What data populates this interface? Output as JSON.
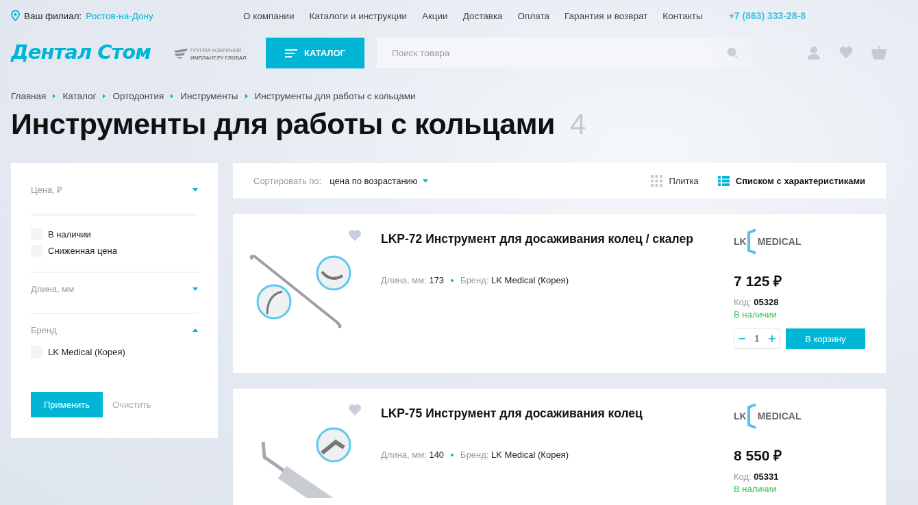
{
  "top_bar": {
    "branch_label": "Ваш филиал:",
    "branch_city": "Ростов-на-Дону",
    "nav": [
      "О компании",
      "Каталоги и инструкции",
      "Акции",
      "Доставка",
      "Оплата",
      "Гарантия и возврат",
      "Контакты"
    ],
    "phone": "+7 (863) 333-28-8"
  },
  "header": {
    "logo": "Дентал Стом",
    "group_caption": "ГРУППА КОМПАНИЙ",
    "group_name": "ИМПЛАНТ.РУ ГЛОБАЛ",
    "catalog_button": "КАТАЛОГ",
    "search": {
      "placeholder": "Поиск товара"
    }
  },
  "breadcrumbs": [
    "Главная",
    "Каталог",
    "Ортодонтия",
    "Инструменты",
    "Инструменты для работы с кольцами"
  ],
  "title": "Инструменты для работы с кольцами",
  "count": "4",
  "filters": [
    {
      "kind": "section",
      "title": "Цена, ₽",
      "expanded": false
    },
    {
      "kind": "checks",
      "items": [
        {
          "label": "В наличии",
          "checked": false
        },
        {
          "label": "Сниженная цена",
          "checked": false
        }
      ]
    },
    {
      "kind": "section",
      "title": "Длина, мм",
      "expanded": false
    },
    {
      "kind": "section",
      "title": "Бренд",
      "expanded": true,
      "items": [
        {
          "label": "LK Medical (Корея)",
          "checked": false
        }
      ]
    }
  ],
  "filter_buttons": {
    "apply": "Применить",
    "clear": "Очистить"
  },
  "sort": {
    "label": "Сортировать по:",
    "value": "цена по возрастанию"
  },
  "views": [
    {
      "label": "Плитка",
      "kind": "grid",
      "selected": false
    },
    {
      "label": "Списком с характеристиками",
      "kind": "list",
      "selected": true
    }
  ],
  "products": [
    {
      "title": "LKP-72 Инструмент для досаживания колец / скалер",
      "kind": "scaler",
      "specs": [
        {
          "label": "Длина, мм:",
          "value": "173"
        },
        {
          "label": "Бренд:",
          "value": "LK Medical (Корея)"
        }
      ],
      "brand_logo": {
        "left": "LK",
        "right": "MEDICAL"
      },
      "price": "7 125 ₽",
      "code_label": "Код:",
      "code": "05328",
      "stock": "В наличии",
      "quantity": "1",
      "cart_button": "В корзину"
    },
    {
      "title": "LKP-75 Инструмент для досаживания колец",
      "kind": "pusher",
      "specs": [
        {
          "label": "Длина, мм:",
          "value": "140"
        },
        {
          "label": "Бренд:",
          "value": "LK Medical (Корея)"
        }
      ],
      "brand_logo": {
        "left": "LK",
        "right": "MEDICAL"
      },
      "price": "8 550 ₽",
      "code_label": "Код:",
      "code": "05331",
      "stock": "В наличии"
    }
  ]
}
